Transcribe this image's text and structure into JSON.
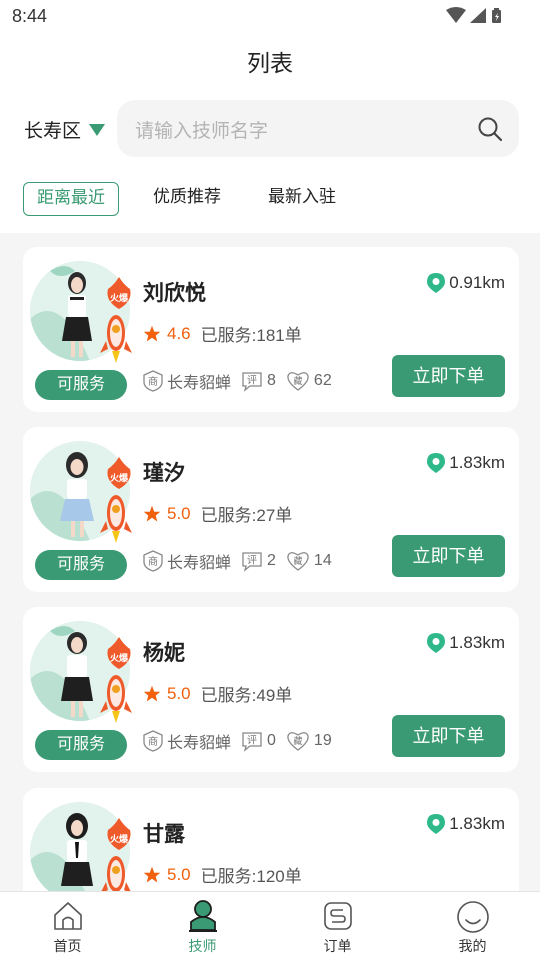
{
  "status_bar": {
    "time": "8:44"
  },
  "header": {
    "title": "列表"
  },
  "location": {
    "district": "长寿区"
  },
  "search": {
    "placeholder": "请输入技师名字"
  },
  "filter_tabs": [
    {
      "label": "距离最近",
      "active": true
    },
    {
      "label": "优质推荐",
      "active": false
    },
    {
      "label": "最新入驻",
      "active": false
    }
  ],
  "hot_badge_text": "火爆",
  "technicians": [
    {
      "name": "刘欣悦",
      "distance": "0.91km",
      "score": "4.6",
      "served": "已服务:181单",
      "status": "可服务",
      "shop": "长寿貂蝉",
      "reviews": "8",
      "favorites": "62",
      "order_label": "立即下单"
    },
    {
      "name": "瑾汐",
      "distance": "1.83km",
      "score": "5.0",
      "served": "已服务:27单",
      "status": "可服务",
      "shop": "长寿貂蝉",
      "reviews": "2",
      "favorites": "14",
      "order_label": "立即下单"
    },
    {
      "name": "杨妮",
      "distance": "1.83km",
      "score": "5.0",
      "served": "已服务:49单",
      "status": "可服务",
      "shop": "长寿貂蝉",
      "reviews": "0",
      "favorites": "19",
      "order_label": "立即下单"
    },
    {
      "name": "甘露",
      "distance": "1.83km",
      "score": "5.0",
      "served": "已服务:120单",
      "status": "",
      "shop": "",
      "reviews": "",
      "favorites": "",
      "order_label": ""
    }
  ],
  "meta_icons": {
    "shop": "商",
    "review": "评",
    "favorite": "藏"
  },
  "tab_bar": [
    {
      "label": "首页",
      "icon": "home-icon",
      "active": false
    },
    {
      "label": "技师",
      "icon": "technician-icon",
      "active": true
    },
    {
      "label": "订单",
      "icon": "order-icon",
      "active": false
    },
    {
      "label": "我的",
      "icon": "profile-icon",
      "active": false
    }
  ],
  "colors": {
    "accent": "#3a9a73",
    "score": "#f0600d",
    "hot": "#ef5a2b"
  }
}
